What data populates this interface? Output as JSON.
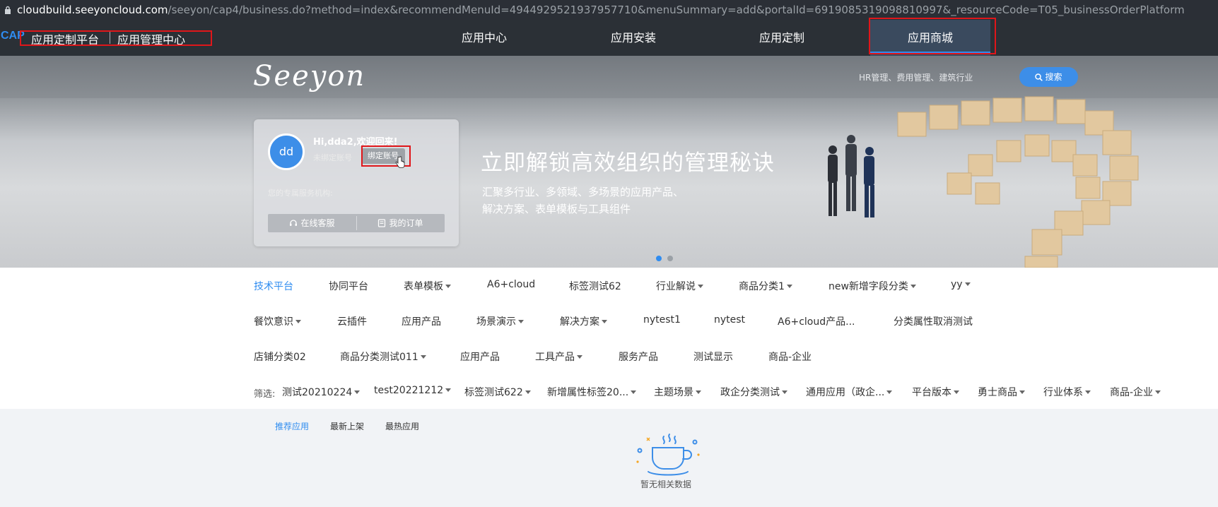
{
  "browser": {
    "url_host": "cloudbuild.seeyoncloud.com",
    "url_path": "/seeyon/cap4/business.do?method=index&recommendMenuId=4944929521937957710&menuSummary=add&portalId=6919085319098810997&_resourceCode=T05_businessOrderPlatform"
  },
  "topnav": {
    "cap": "CAP",
    "platform": "应用定制平台",
    "mgmt": "应用管理中心",
    "tabs": [
      "应用中心",
      "应用安装",
      "应用定制",
      "应用商城"
    ]
  },
  "banner": {
    "logo": "Seeyon",
    "hot_keywords": "HR管理、费用管理、建筑行业",
    "search_label": "搜索",
    "greeting": "Hi,dda2,欢迎回来!",
    "avatar": "dd",
    "unbound": "未绑定账号",
    "bind_button": "绑定账号",
    "org_label": "您的专属服务机构:",
    "online_service": "在线客服",
    "my_orders": "我的订单",
    "headline": "立即解锁高效组织的管理秘诀",
    "sub_line1": "汇聚多行业、多领域、多场景的应用产品、",
    "sub_line2": "解决方案、表单模板与工具组件"
  },
  "categories": {
    "row1": [
      "技术平台",
      "协同平台",
      "表单模板",
      "A6+cloud",
      "标签测试62",
      "行业解说",
      "商品分类1",
      "new新增字段分类",
      "yy"
    ],
    "row2": [
      "餐饮意识",
      "云插件",
      "应用产品",
      "场景演示",
      "解决方案",
      "nytest1",
      "nytest",
      "A6+cloud产品...",
      "分类属性取消测试"
    ],
    "row3": [
      "店铺分类02",
      "商品分类测试011",
      "应用产品",
      "工具产品",
      "服务产品",
      "测试显示",
      "商品-企业"
    ],
    "filter_label": "筛选:",
    "row4": [
      "测试20210224",
      "test20221212",
      "标签测试622",
      "新增属性标签20...",
      "主题场景",
      "政企分类测试",
      "通用应用（政企...",
      "平台版本",
      "勇士商品",
      "行业体系",
      "商品-企业"
    ]
  },
  "tabs": [
    "推荐应用",
    "最新上架",
    "最热应用"
  ],
  "empty_text": "暂无相关数据",
  "colors": {
    "accent": "#2f8cf0",
    "nav_bg": "#2b3036",
    "highlight": "#e0161a"
  }
}
